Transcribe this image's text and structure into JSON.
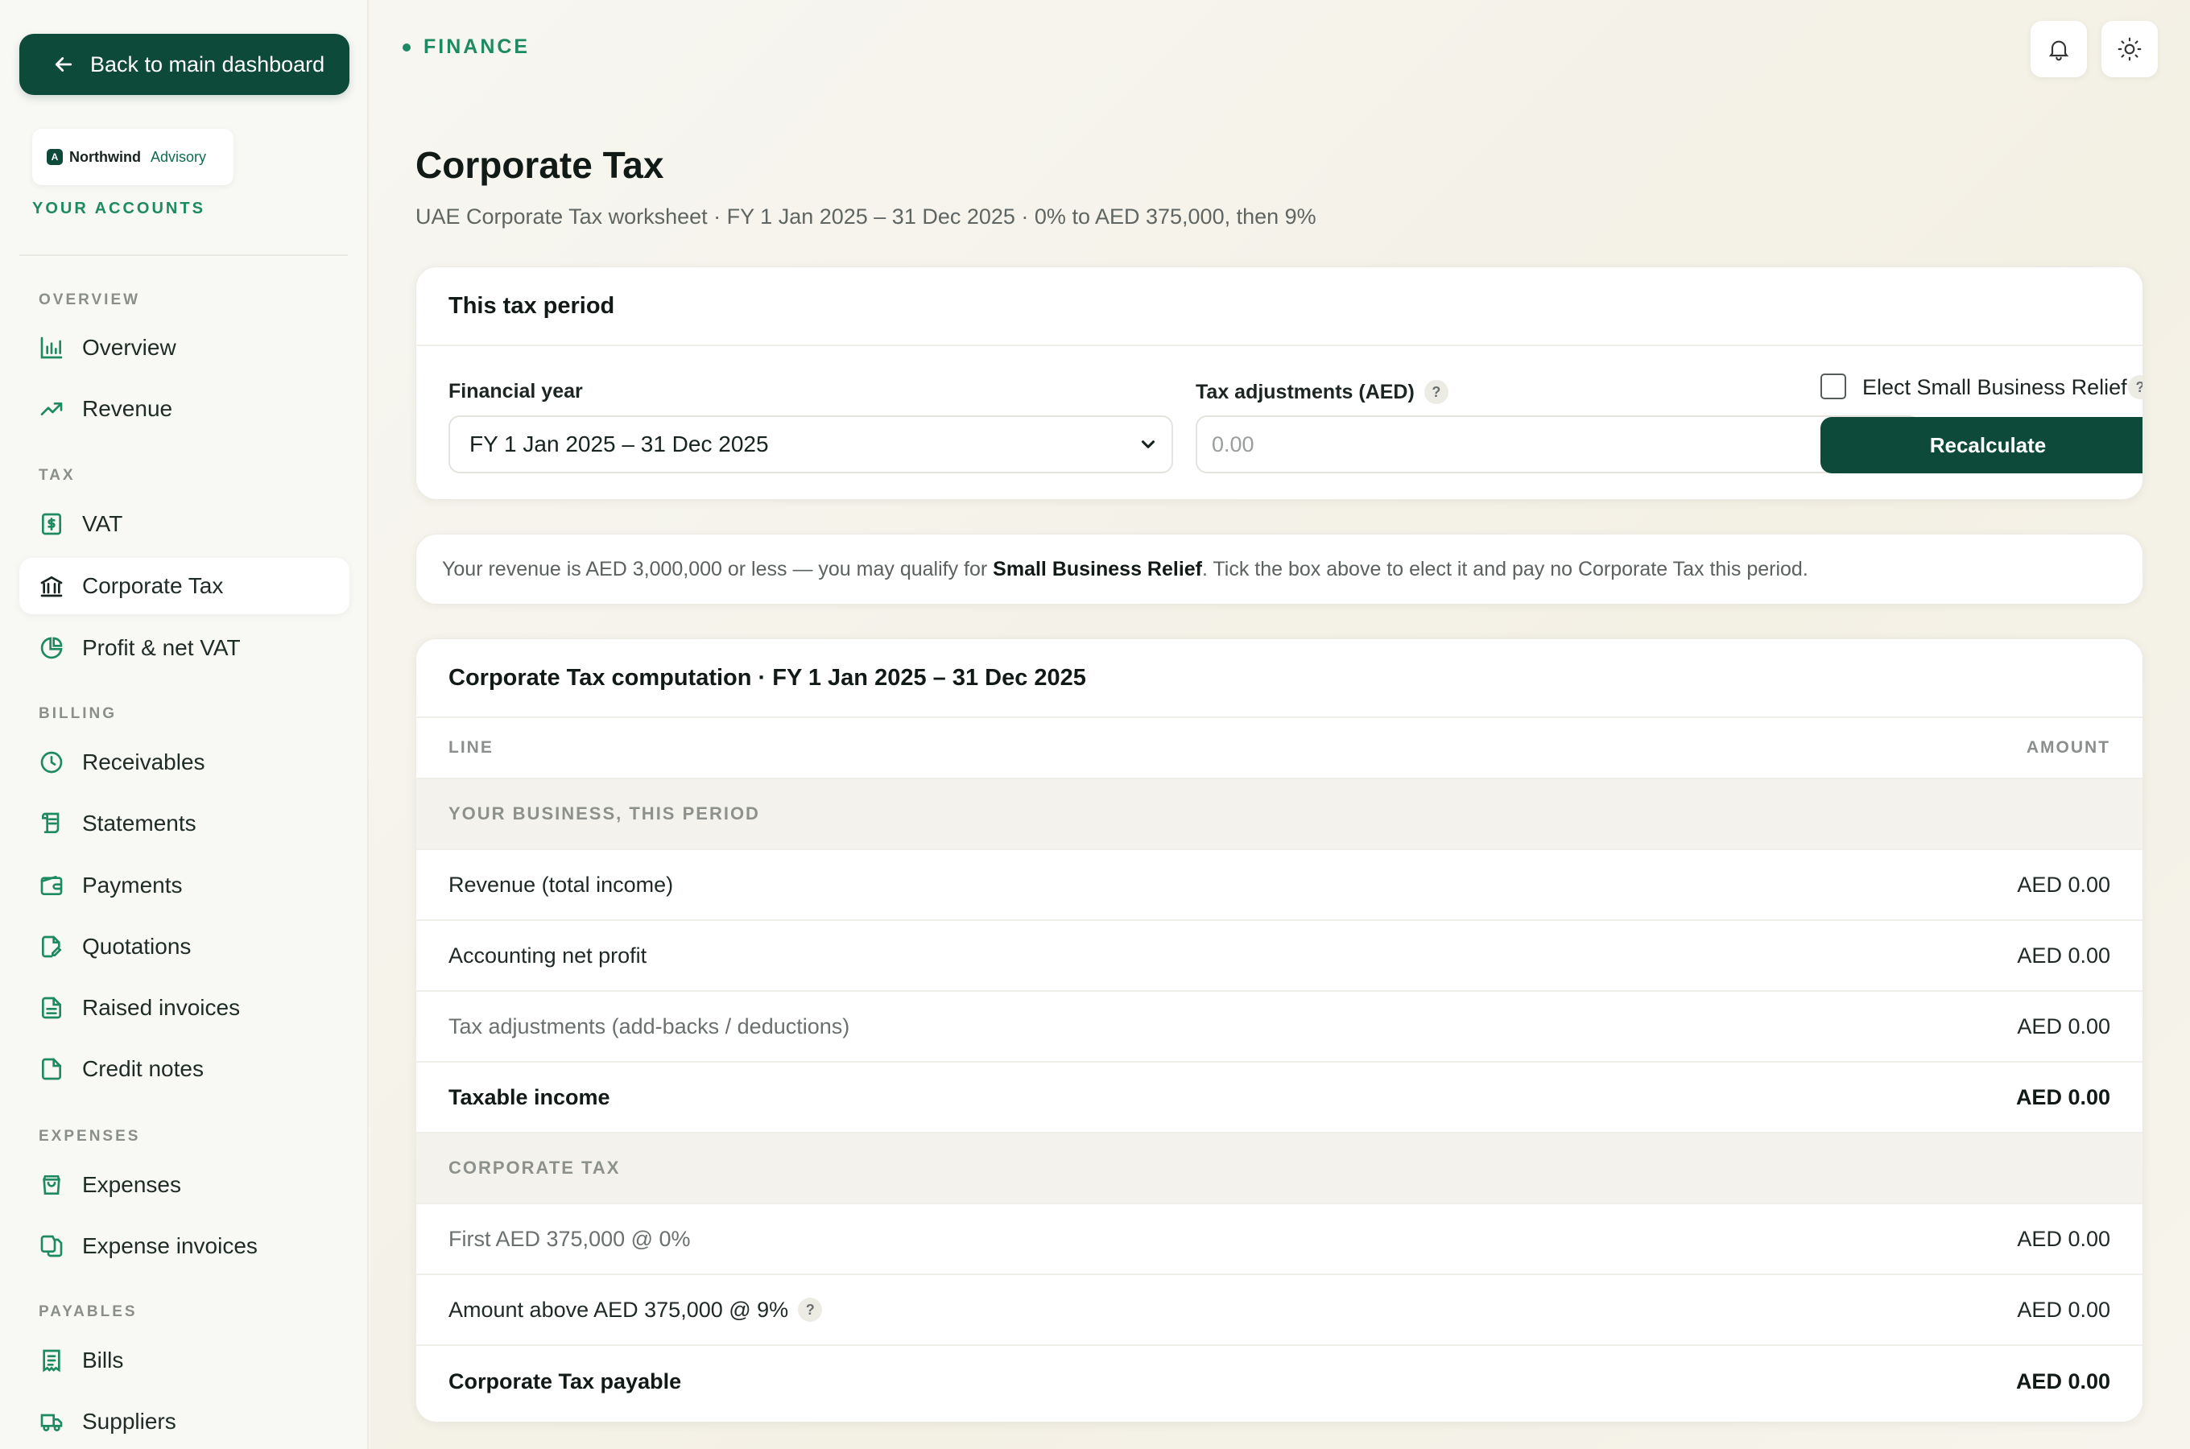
{
  "sidebar": {
    "back_label": "Back to main dashboard",
    "brand": {
      "name": "Northwind",
      "sub": "Advisory",
      "mark": "A"
    },
    "your_accounts": "YOUR ACCOUNTS",
    "sections": {
      "overview": "OVERVIEW",
      "tax": "TAX",
      "billing": "BILLING",
      "expenses": "EXPENSES",
      "payables": "PAYABLES"
    },
    "items": {
      "overview": "Overview",
      "revenue": "Revenue",
      "vat": "VAT",
      "corporate_tax": "Corporate Tax",
      "profit_vat": "Profit & net VAT",
      "receivables": "Receivables",
      "statements": "Statements",
      "payments": "Payments",
      "quotations": "Quotations",
      "raised_invoices": "Raised invoices",
      "credit_notes": "Credit notes",
      "expenses": "Expenses",
      "expense_invoices": "Expense invoices",
      "bills": "Bills",
      "suppliers": "Suppliers"
    }
  },
  "header": {
    "breadcrumb": "FINANCE",
    "title": "Corporate Tax",
    "subtitle": "UAE Corporate Tax worksheet · FY 1 Jan 2025 – 31 Dec 2025 · 0% to AED 375,000, then 9%"
  },
  "period_card": {
    "title": "This tax period",
    "financial_year_label": "Financial year",
    "financial_year_value": "FY 1 Jan 2025 – 31 Dec 2025",
    "adjustments_label": "Tax adjustments (AED)",
    "adjustments_placeholder": "0.00",
    "help_glyph": "?",
    "sbr_label": "Elect Small Business Relief",
    "recalc_label": "Recalculate"
  },
  "notice": {
    "before": "Your revenue is AED 3,000,000 or less — you may qualify for ",
    "bold": "Small Business Relief",
    "after": ". Tick the box above to elect it and pay no Corporate Tax this period."
  },
  "computation": {
    "title": "Corporate Tax computation · FY 1 Jan 2025 – 31 Dec 2025",
    "col_line": "LINE",
    "col_amount": "AMOUNT",
    "section_business": "YOUR BUSINESS, THIS PERIOD",
    "revenue_label": "Revenue (total income)",
    "revenue_amount": "AED 0.00",
    "profit_label": "Accounting net profit",
    "profit_amount": "AED 0.00",
    "adjust_label": "Tax adjustments (add-backs / deductions)",
    "adjust_amount": "AED 0.00",
    "taxable_label": "Taxable income",
    "taxable_amount": "AED 0.00",
    "section_ct": "CORPORATE TAX",
    "first_band_label": "First AED 375,000 @ 0%",
    "first_band_amount": "AED 0.00",
    "above_band_label": "Amount above AED 375,000 @ 9%",
    "above_band_amount": "AED 0.00",
    "payable_label": "Corporate Tax payable",
    "payable_amount": "AED 0.00"
  }
}
